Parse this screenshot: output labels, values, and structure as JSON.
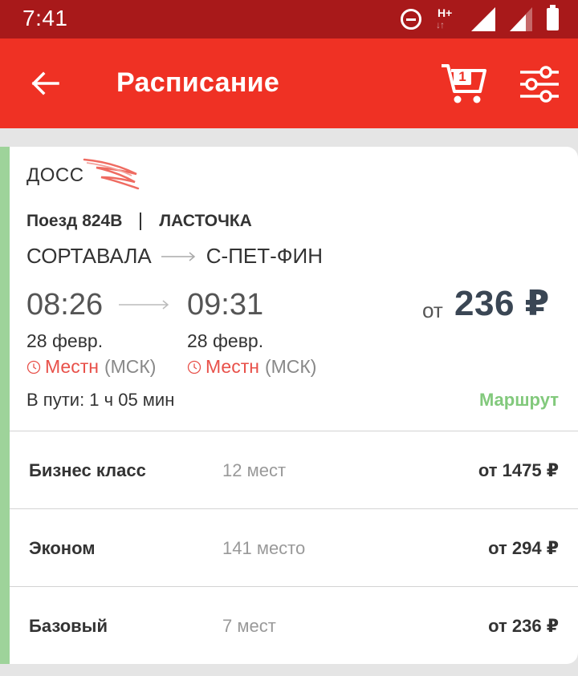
{
  "status_bar": {
    "time": "7:41",
    "network": "H+"
  },
  "app_bar": {
    "title": "Расписание",
    "cart_count": "1"
  },
  "train": {
    "carrier": "ДОСС",
    "number": "Поезд 824В",
    "name": "ЛАСТОЧКА",
    "from": "СОРТАВАЛА",
    "to": "С-ПЕТ-ФИН",
    "departure": {
      "time": "08:26",
      "date": "28 февр.",
      "tz_local": "Местн",
      "tz_msk": "(МСК)"
    },
    "arrival": {
      "time": "09:31",
      "date": "28 февр.",
      "tz_local": "Местн",
      "tz_msk": "(МСК)"
    },
    "price_from_label": "от",
    "price_from": "236 ₽",
    "duration": "В пути: 1 ч 05 мин",
    "route_link": "Маршрут"
  },
  "classes": [
    {
      "name": "Бизнес класс",
      "seats": "12 мест",
      "price": "от 1475 ₽"
    },
    {
      "name": "Эконом",
      "seats": "141 место",
      "price": "от 294 ₽"
    },
    {
      "name": "Базовый",
      "seats": "7 мест",
      "price": "от 236 ₽"
    }
  ],
  "colors": {
    "status_bar": "#a8191a",
    "app_bar": "#ef3124",
    "accent_green": "#9ed39a",
    "route_link": "#82c97c",
    "local_tz": "#e8514a"
  }
}
